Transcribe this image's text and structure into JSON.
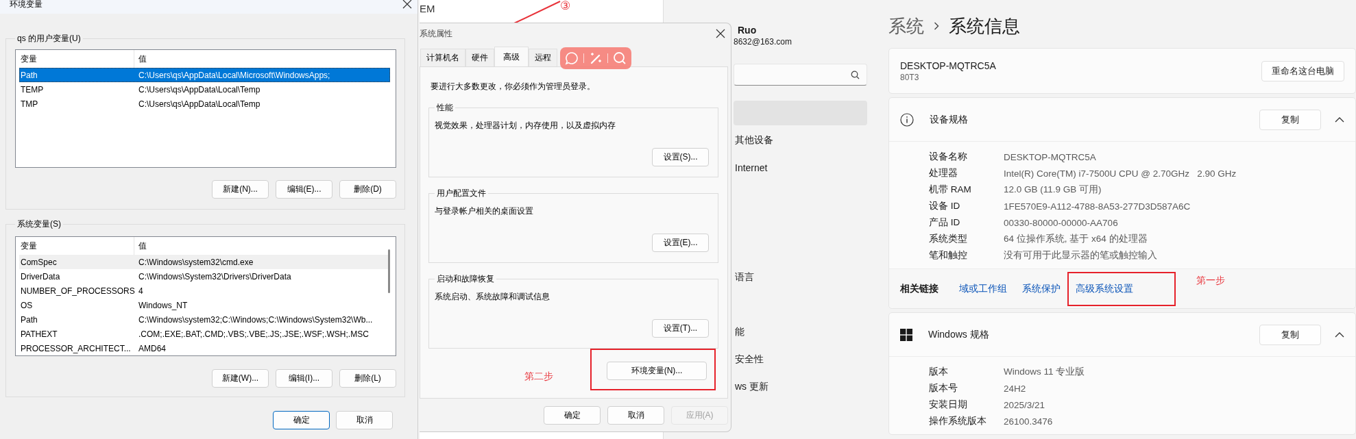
{
  "env_window": {
    "title": "环境变量",
    "user_variables": {
      "label": "qs 的用户变量(U)",
      "focused": true,
      "columns": [
        "变量",
        "值"
      ],
      "rows": [
        {
          "name": "Path",
          "value": "C:\\Users\\qs\\AppData\\Local\\Microsoft\\WindowsApps;",
          "selected": true
        },
        {
          "name": "TEMP",
          "value": "C:\\Users\\qs\\AppData\\Local\\Temp",
          "selected": false
        },
        {
          "name": "TMP",
          "value": "C:\\Users\\qs\\AppData\\Local\\Temp",
          "selected": false
        }
      ],
      "buttons": [
        "新建(N)...",
        "编辑(E)...",
        "删除(D)"
      ]
    },
    "system_variables": {
      "label": "系统变量(S)",
      "focused": false,
      "columns": [
        "变量",
        "值"
      ],
      "rows": [
        {
          "name": "ComSpec",
          "value": "C:\\Windows\\system32\\cmd.exe",
          "selected": true
        },
        {
          "name": "DriverData",
          "value": "C:\\Windows\\System32\\Drivers\\DriverData",
          "selected": false
        },
        {
          "name": "NUMBER_OF_PROCESSORS",
          "value": "4",
          "selected": false
        },
        {
          "name": "OS",
          "value": "Windows_NT",
          "selected": false
        },
        {
          "name": "Path",
          "value": "C:\\Windows\\system32;C:\\Windows;C:\\Windows\\System32\\Wb...",
          "selected": false
        },
        {
          "name": "PATHEXT",
          "value": ".COM;.EXE;.BAT;.CMD;.VBS;.VBE;.JS;.JSE;.WSF;.WSH;.MSC",
          "selected": false
        },
        {
          "name": "PROCESSOR_ARCHITECT...",
          "value": "AMD64",
          "selected": false
        }
      ],
      "buttons": [
        "新建(W)...",
        "编辑(I)...",
        "删除(L)"
      ]
    },
    "buttons": [
      {
        "label": "确定",
        "default": true
      },
      {
        "label": "取消",
        "default": false
      }
    ]
  },
  "background_window": {
    "text": "EM"
  },
  "annotation": {
    "marker": "③"
  },
  "system_properties": {
    "title": "系统属性",
    "tabs": [
      {
        "label": "计算机名",
        "selected": false
      },
      {
        "label": "硬件",
        "selected": false
      },
      {
        "label": "高级",
        "selected": true
      },
      {
        "label": "远程",
        "selected": false
      }
    ],
    "notice": "要进行大多数更改，你必须作为管理员登录。",
    "groups": [
      {
        "label": "性能",
        "description": "视觉效果，处理器计划，内存使用，以及虚拟内存",
        "button": "设置(S)..."
      },
      {
        "label": "用户配置文件",
        "description": "与登录帐户相关的桌面设置",
        "button": "设置(E)..."
      },
      {
        "label": "启动和故障恢复",
        "description": "系统启动、系统故障和调试信息",
        "button": "设置(T)..."
      }
    ],
    "step_label": "第二步",
    "env_button": {
      "label": "环境变量(N)...",
      "highlighted": true
    },
    "buttons": [
      {
        "label": "确定",
        "disabled": false
      },
      {
        "label": "取消",
        "disabled": false
      },
      {
        "label": "应用(A)",
        "disabled": true
      }
    ]
  },
  "settings": {
    "account": {
      "name": "Ruo",
      "email": "8632@163.com"
    },
    "nav": [
      {
        "selected": true
      },
      {
        "label": "其他设备",
        "selected": false
      },
      {
        "label": "Internet",
        "selected": false
      },
      {
        "label": "语言",
        "selected": false
      },
      {
        "label": "能",
        "selected": false
      },
      {
        "label": "安全性",
        "selected": false
      },
      {
        "label": "ws 更新",
        "selected": false
      }
    ],
    "breadcrumb": [
      "系统",
      "系统信息"
    ],
    "device": {
      "name": "DESKTOP-MQTRC5A",
      "model": "80T3",
      "button": "重命名这台电脑"
    },
    "device_specs": {
      "title": "设备规格",
      "button": "复制",
      "expanded": true,
      "rows": [
        {
          "label": "设备名称",
          "value": "DESKTOP-MQTRC5A"
        },
        {
          "label": "处理器",
          "value": "Intel(R) Core(TM) i7-7500U CPU @ 2.70GHz   2.90 GHz"
        },
        {
          "label": "机带 RAM",
          "value": "12.0 GB (11.9 GB 可用)"
        },
        {
          "label": "设备 ID",
          "value": "1FE570E9-A112-4788-8A53-277D3D587A6C"
        },
        {
          "label": "产品 ID",
          "value": "00330-80000-00000-AA706"
        },
        {
          "label": "系统类型",
          "value": "64 位操作系统, 基于 x64 的处理器"
        },
        {
          "label": "笔和触控",
          "value": "没有可用于此显示器的笔或触控输入"
        }
      ],
      "related": {
        "label": "相关链接",
        "links": [
          {
            "label": "域或工作组",
            "highlighted": false
          },
          {
            "label": "系统保护",
            "highlighted": false
          },
          {
            "label": "高级系统设置",
            "highlighted": true
          }
        ]
      },
      "step_label": "第一步"
    },
    "windows_specs": {
      "title": "Windows 规格",
      "button": "复制",
      "expanded": true,
      "rows": [
        {
          "label": "版本",
          "value": "Windows 11 专业版"
        },
        {
          "label": "版本号",
          "value": "24H2"
        },
        {
          "label": "安装日期",
          "value": "2025/3/21"
        },
        {
          "label": "操作系统版本",
          "value": "26100.3476"
        }
      ]
    }
  }
}
